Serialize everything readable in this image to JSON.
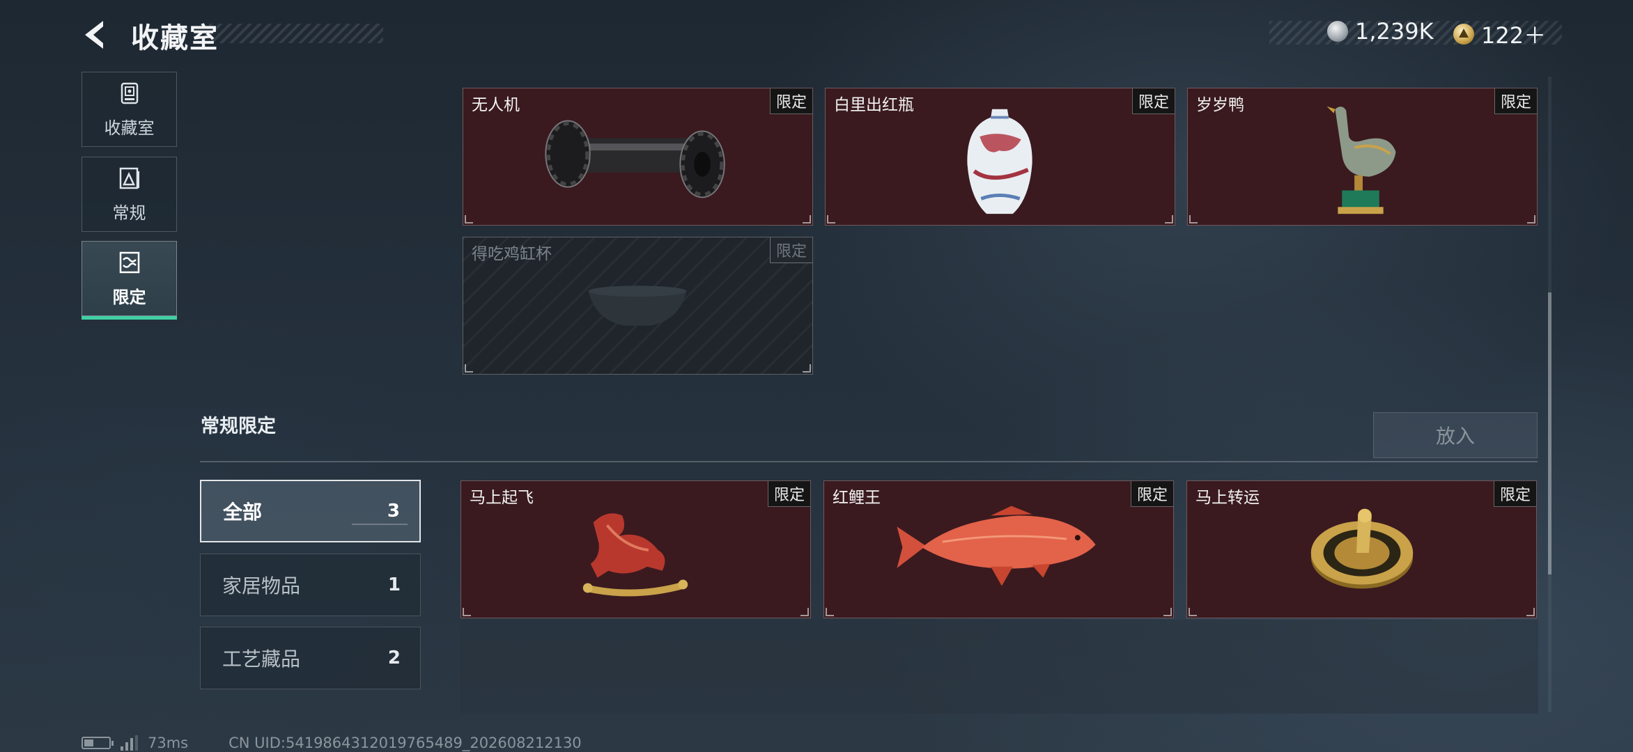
{
  "header": {
    "title": "收藏室",
    "currency_silver": "1,239K",
    "currency_gold": "122＋"
  },
  "nav": {
    "items": [
      {
        "label": "收藏室",
        "icon": "collection-room-icon",
        "active": false
      },
      {
        "label": "常规",
        "icon": "regular-icon",
        "active": false
      },
      {
        "label": "限定",
        "icon": "limited-icon",
        "active": true
      }
    ]
  },
  "top_grid": {
    "cards": [
      {
        "name": "无人机",
        "badge": "限定",
        "art": "roller-drone-image",
        "locked": false
      },
      {
        "name": "白里出红瓶",
        "badge": "限定",
        "art": "porcelain-vase-image",
        "locked": false
      },
      {
        "name": "岁岁鸭",
        "badge": "限定",
        "art": "duck-statue-image",
        "locked": false
      },
      {
        "name": "得吃鸡缸杯",
        "badge": "限定",
        "art": "cup-image",
        "locked": true
      }
    ]
  },
  "section": {
    "title": "常规限定",
    "put_in_label": "放入"
  },
  "filters": [
    {
      "label": "全部",
      "count": "3",
      "active": true
    },
    {
      "label": "家居物品",
      "count": "1",
      "active": false
    },
    {
      "label": "工艺藏品",
      "count": "2",
      "active": false
    }
  ],
  "bottom_grid": {
    "cards": [
      {
        "name": "马上起飞",
        "badge": "限定",
        "art": "horse-statue-image"
      },
      {
        "name": "红鲤王",
        "badge": "限定",
        "art": "red-carp-image"
      },
      {
        "name": "马上转运",
        "badge": "限定",
        "art": "golden-compass-image"
      }
    ]
  },
  "status": {
    "ping": "73ms",
    "uid": "CN UID:5419864312019765489_202608212130"
  },
  "colors": {
    "card_bg": "#3a1a1f",
    "accent": "#3fd0a4"
  }
}
